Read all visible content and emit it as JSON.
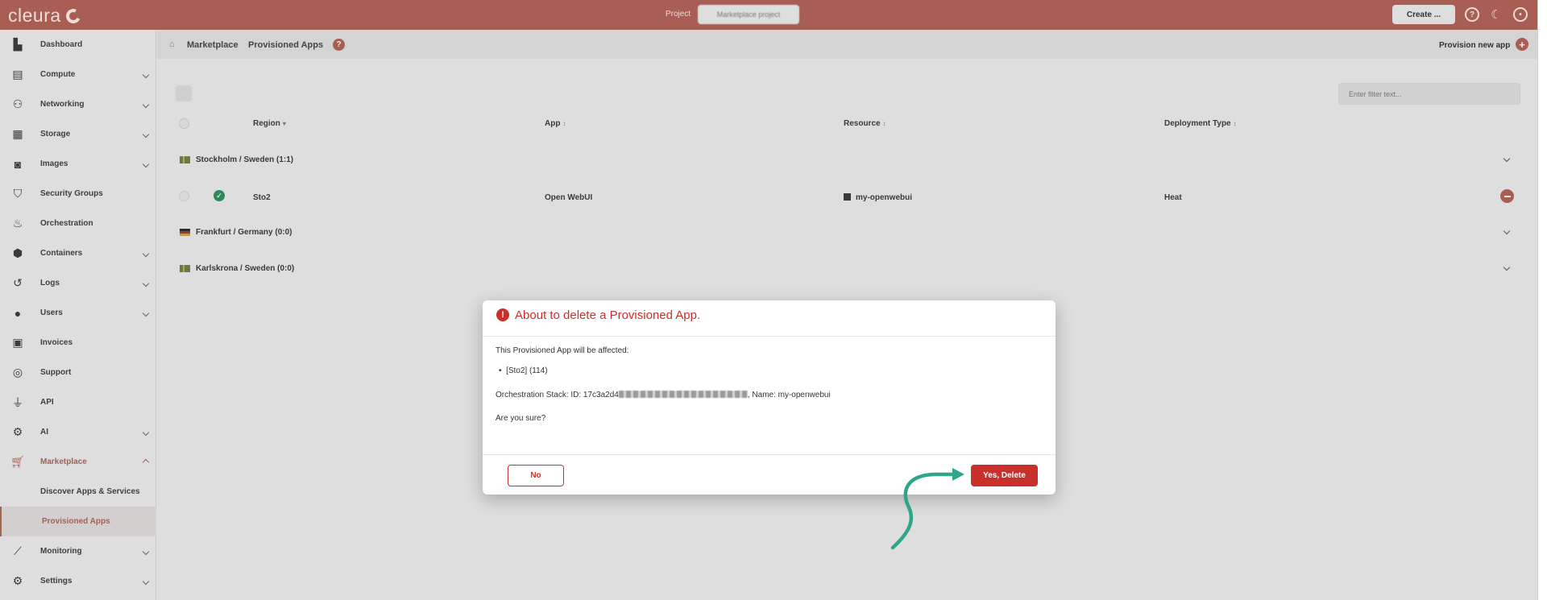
{
  "topbar": {
    "logo_text": "cleura",
    "project_label": "Project",
    "project_value": "Marketplace project",
    "create_label": "Create ...",
    "help_icon": "question-circle-icon",
    "theme_icon": "moon-icon",
    "account_icon": "user-circle-icon",
    "brand_color": "#a85e53"
  },
  "sidebar": {
    "items": [
      {
        "label": "Dashboard",
        "icon": "chart-icon"
      },
      {
        "label": "Compute",
        "icon": "server-icon"
      },
      {
        "label": "Networking",
        "icon": "network-icon"
      },
      {
        "label": "Storage",
        "icon": "database-icon"
      },
      {
        "label": "Images",
        "icon": "camera-icon"
      },
      {
        "label": "Security Groups",
        "icon": "shield-icon"
      },
      {
        "label": "Orchestration",
        "icon": "orchestration-icon"
      },
      {
        "label": "Containers",
        "icon": "cube-icon"
      },
      {
        "label": "Logs",
        "icon": "history-icon"
      },
      {
        "label": "Users",
        "icon": "user-icon"
      },
      {
        "label": "Invoices",
        "icon": "calculator-icon"
      },
      {
        "label": "Support",
        "icon": "lifebuoy-icon"
      },
      {
        "label": "API",
        "icon": "plug-icon"
      },
      {
        "label": "AI",
        "icon": "ai-icon"
      },
      {
        "label": "Marketplace",
        "icon": "cart-icon"
      },
      {
        "label": "Monitoring",
        "icon": "line-chart-icon"
      },
      {
        "label": "Settings",
        "icon": "gear-icon"
      }
    ],
    "sub_items": [
      {
        "label": "Discover Apps & Services"
      },
      {
        "label": "Provisioned Apps"
      }
    ]
  },
  "breadcrumb": {
    "items": [
      "Marketplace",
      "Provisioned Apps"
    ],
    "provision_label": "Provision new app"
  },
  "table": {
    "filter_placeholder": "Enter filter text...",
    "headers": {
      "region": "Region",
      "app": "App",
      "resource": "Resource",
      "deployment": "Deployment Type"
    },
    "groups": [
      {
        "label": "Stockholm / Sweden (1:1)",
        "flag": "sweden-flag-icon"
      },
      {
        "label": "Frankfurt / Germany (0:0)",
        "flag": "germany-flag-icon"
      },
      {
        "label": "Karlskrona / Sweden (0:0)",
        "flag": "sweden-flag-icon"
      }
    ],
    "row": {
      "region": "Sto2",
      "app": "Open WebUI",
      "resource": "my-openwebui",
      "deployment": "Heat",
      "status": "ok"
    }
  },
  "modal": {
    "title": "About to delete a Provisioned App.",
    "affected_text": "This Provisioned App will be affected:",
    "affected_item": "[Sto2] (114)",
    "stack_prefix": "Orchestration Stack: ID: 17c3a2d4",
    "stack_suffix": ", Name: my-openwebui",
    "confirm_text": "Are you sure?",
    "no_label": "No",
    "yes_label": "Yes, Delete",
    "danger_color": "#c9302c"
  },
  "annotation": {
    "arrow_color": "#2fa58c"
  }
}
